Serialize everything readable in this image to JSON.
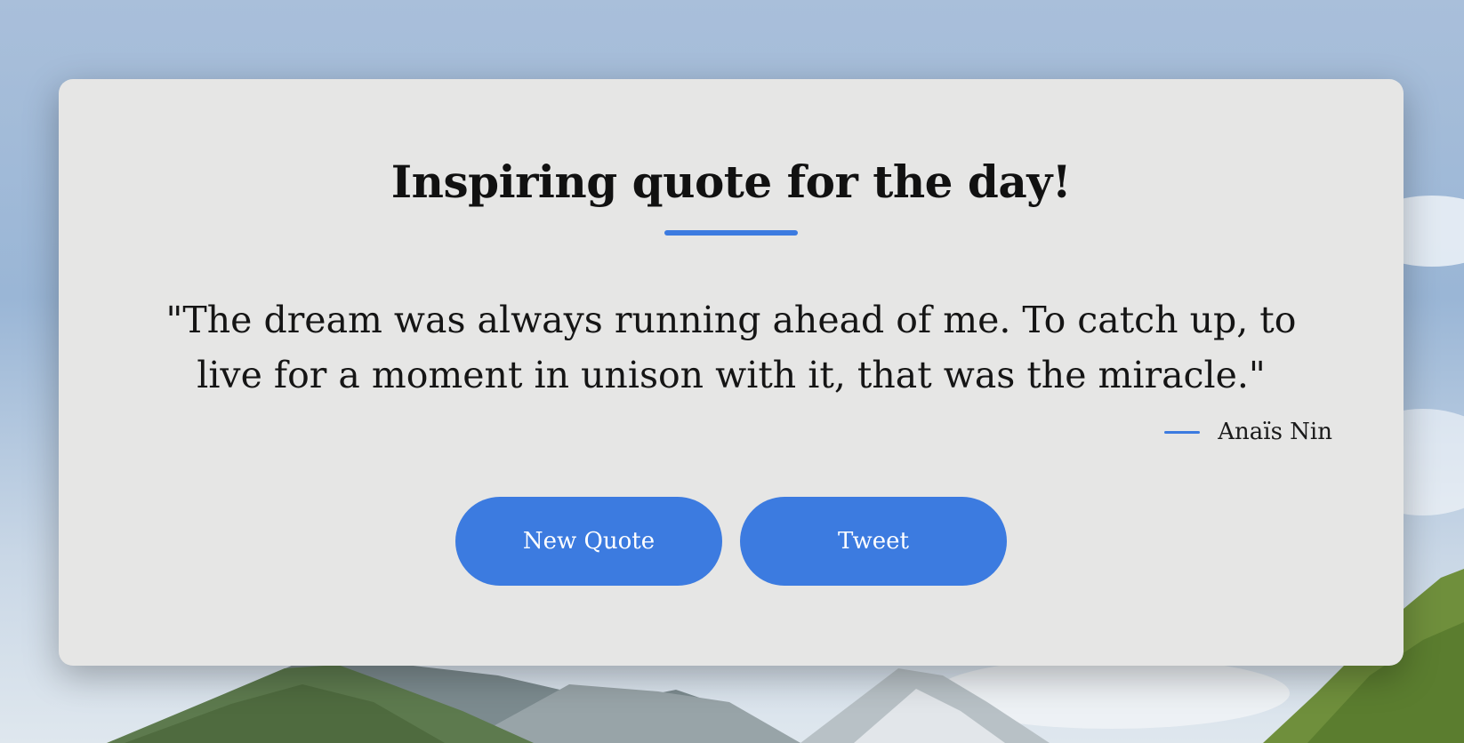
{
  "page": {
    "title": "Inspiring quote for the day!",
    "quote": "\"The dream was always running ahead of me. To catch up, to live for a moment in unison with it, that was the miracle.\"",
    "author": "Anaïs Nin"
  },
  "buttons": {
    "new_quote": "New Quote",
    "tweet": "Tweet"
  },
  "colors": {
    "accent": "#3c7be0",
    "card": "#e6e6e5",
    "text": "#111111"
  },
  "background": {
    "description_icon": "mountain-landscape"
  }
}
